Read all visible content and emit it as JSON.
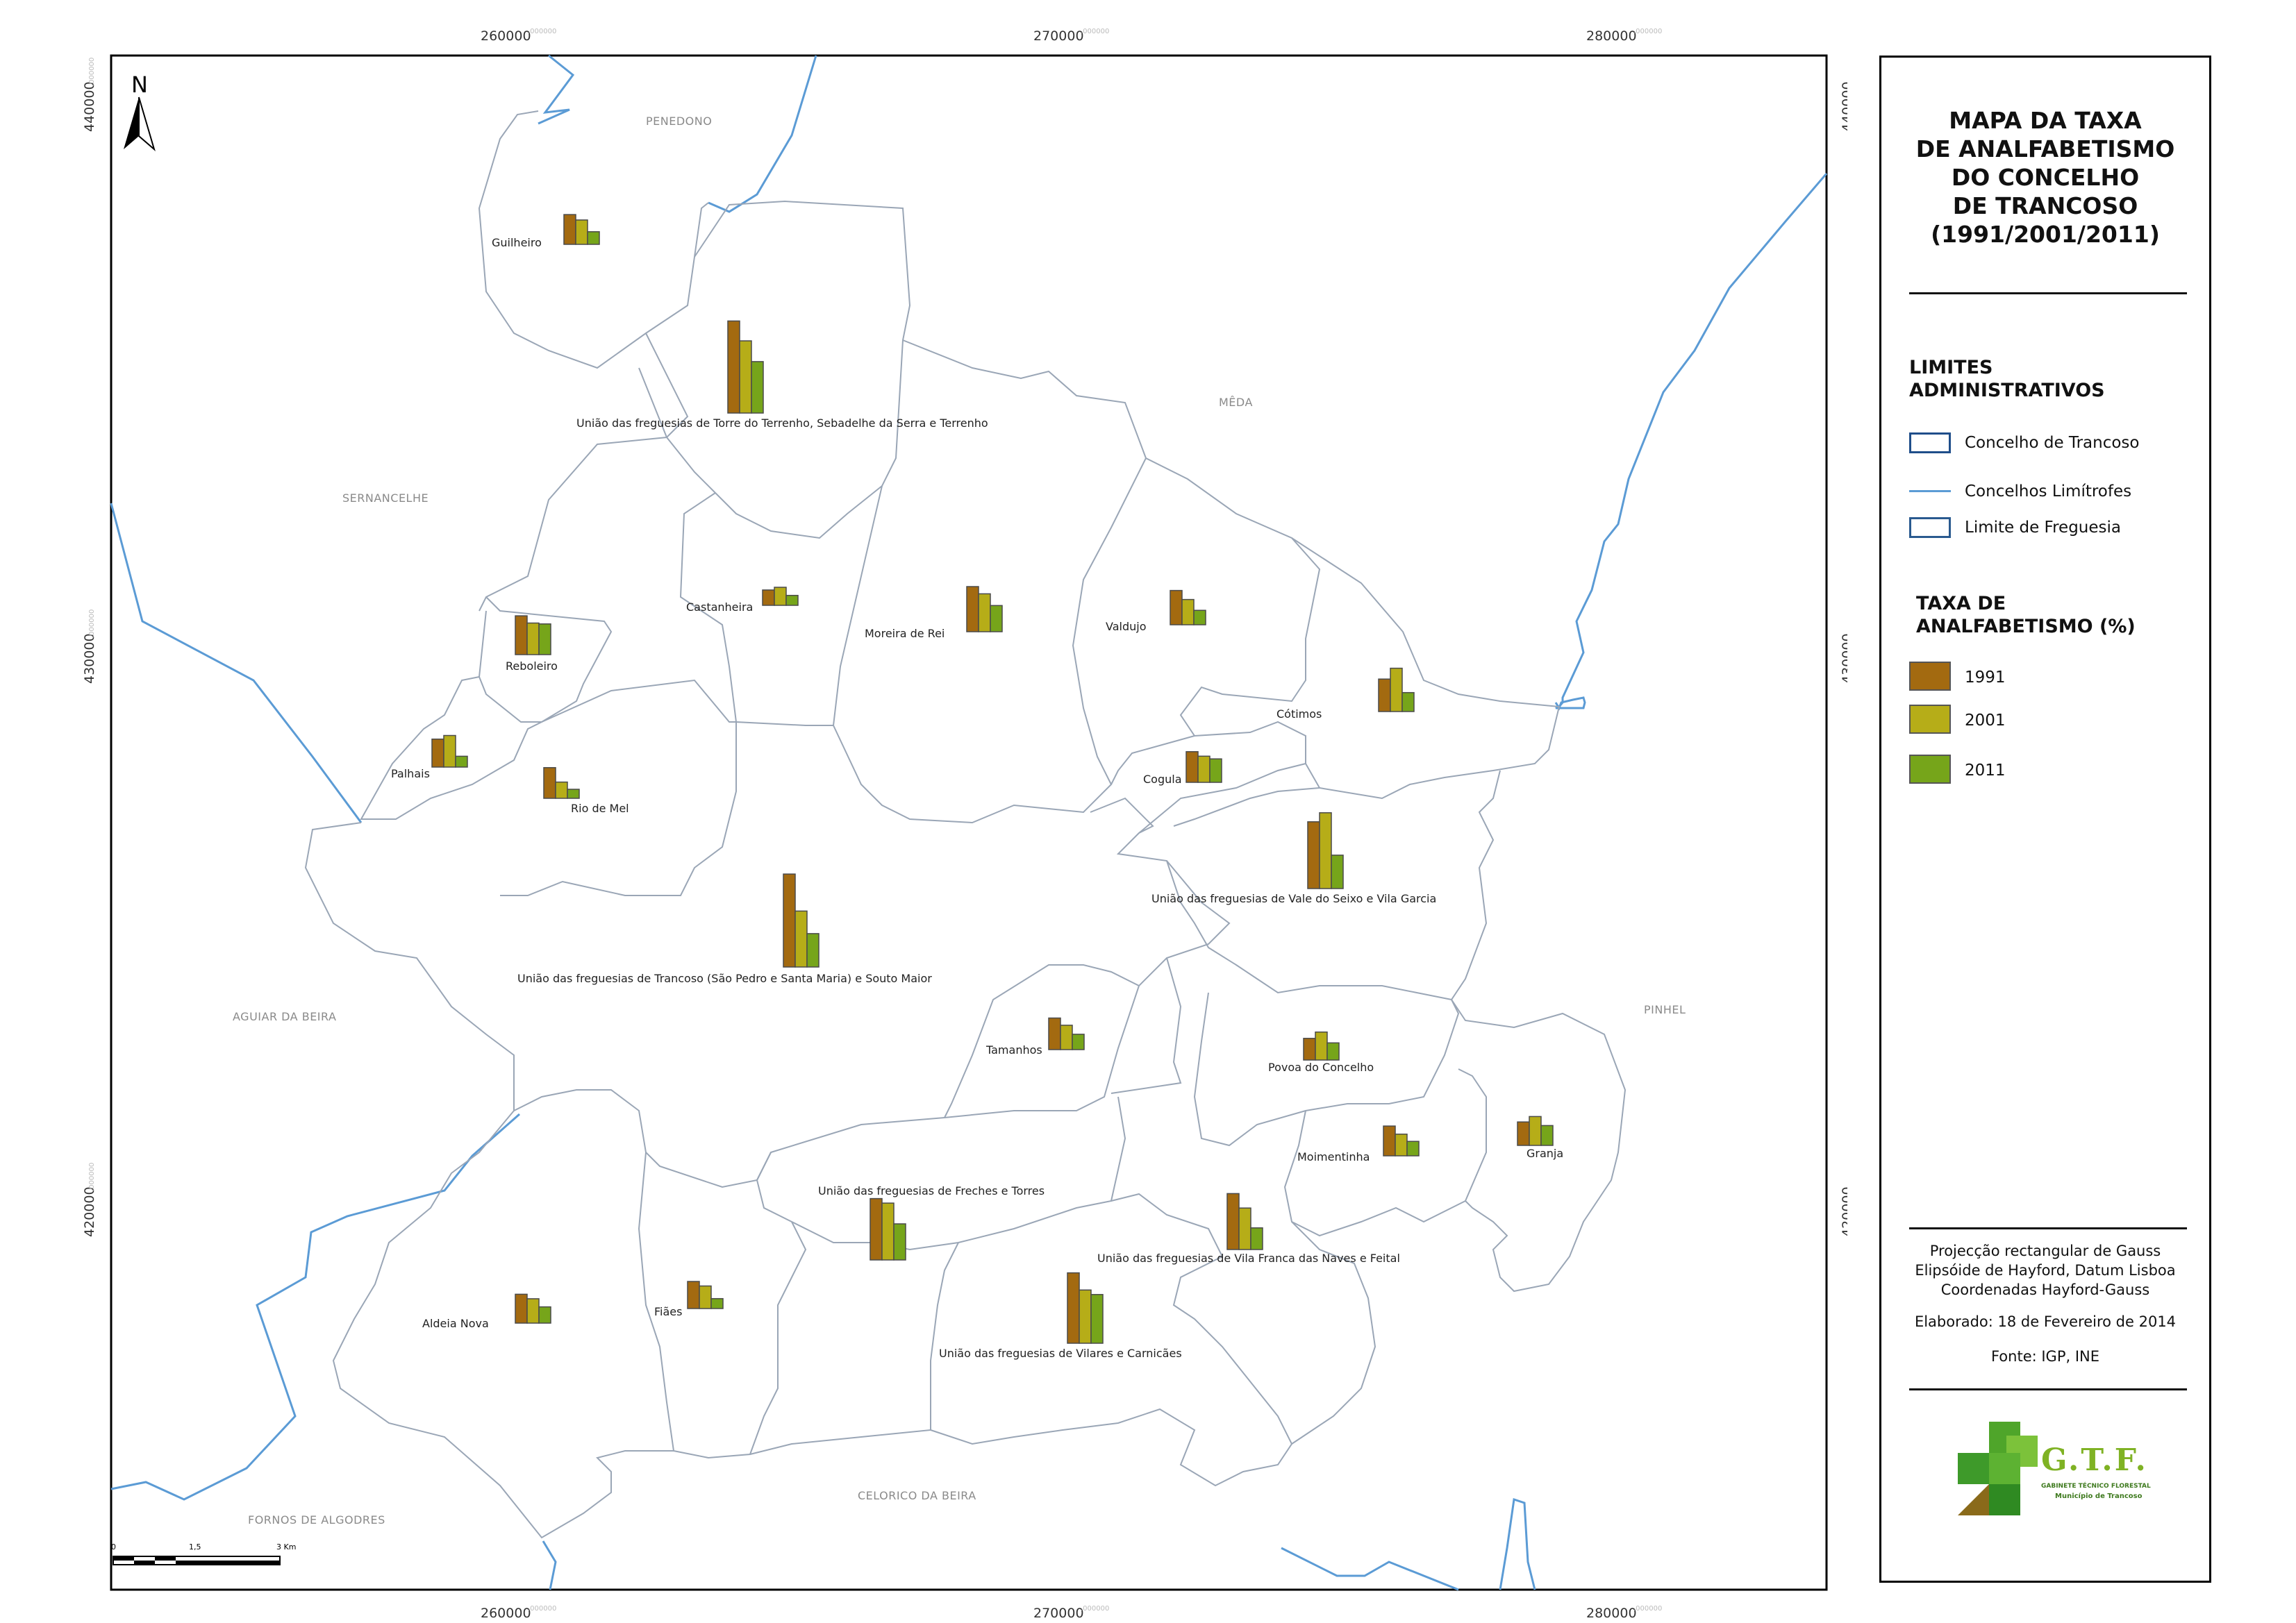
{
  "map": {
    "title": "MAPA DA TAXA\nDE ANALFABETISMO\nDO CONCELHO\nDE TRANCOSO\n(1991/2001/2011)",
    "north_arrow_label": "N",
    "grid": {
      "x_ticks": [
        {
          "label": "260000",
          "fraction": ".000000"
        },
        {
          "label": "270000",
          "fraction": ".000000"
        },
        {
          "label": "280000",
          "fraction": ".000000"
        }
      ],
      "y_ticks": [
        {
          "label": "440000",
          "fraction": ".000000"
        },
        {
          "label": "430000",
          "fraction": ".000000"
        },
        {
          "label": "420000",
          "fraction": ".000000"
        }
      ]
    },
    "scale_bar": {
      "labels": [
        "0",
        "1,5",
        "3 Km"
      ]
    },
    "neighbor_municipalities": [
      "PENEDONO",
      "MÊDA",
      "SERNANCELHE",
      "AGUIAR DA BEIRA",
      "PINHEL",
      "CELORICO DA BEIRA",
      "FORNOS DE ALGODRES"
    ],
    "parishes": [
      {
        "name": "Guilheiro",
        "rates": {
          "1991": 33,
          "2001": 27,
          "2011": 14
        }
      },
      {
        "name": "União das freguesias de Torre do Terrenho, Sebadelhe da Serra e Terrenho",
        "rates": {
          "1991": 102,
          "2001": 80,
          "2011": 57
        }
      },
      {
        "name": "Castanheira",
        "rates": {
          "1991": 17,
          "2001": 20,
          "2011": 11
        }
      },
      {
        "name": "Moreira de Rei",
        "rates": {
          "1991": 50,
          "2001": 42,
          "2011": 29
        }
      },
      {
        "name": "Valdujo",
        "rates": {
          "1991": 38,
          "2001": 28,
          "2011": 16
        }
      },
      {
        "name": "Reboleiro",
        "rates": {
          "1991": 43,
          "2001": 35,
          "2011": 34
        }
      },
      {
        "name": "Cótimos",
        "rates": {
          "1991": 36,
          "2001": 48,
          "2011": 21
        }
      },
      {
        "name": "Palhais",
        "rates": {
          "1991": 31,
          "2001": 35,
          "2011": 12
        }
      },
      {
        "name": "Rio de Mel",
        "rates": {
          "1991": 34,
          "2001": 18,
          "2011": 10
        }
      },
      {
        "name": "Cogula",
        "rates": {
          "1991": 34,
          "2001": 29,
          "2011": 26
        }
      },
      {
        "name": "União das freguesias de Vale do Seixo e Vila Garcia",
        "rates": {
          "1991": 74,
          "2001": 84,
          "2011": 37
        }
      },
      {
        "name": "União das freguesias de Trancoso (São Pedro e Santa Maria) e Souto Maior",
        "rates": {
          "1991": 103,
          "2001": 62,
          "2011": 37
        }
      },
      {
        "name": "Tamanhos",
        "rates": {
          "1991": 35,
          "2001": 27,
          "2011": 17
        }
      },
      {
        "name": "Povoa do Concelho",
        "rates": {
          "1991": 24,
          "2001": 31,
          "2011": 19
        }
      },
      {
        "name": "Moimentinha",
        "rates": {
          "1991": 33,
          "2001": 24,
          "2011": 16
        }
      },
      {
        "name": "Granja",
        "rates": {
          "1991": 26,
          "2001": 32,
          "2011": 22
        }
      },
      {
        "name": "União das freguesias de Freches e Torres",
        "rates": {
          "1991": 68,
          "2001": 63,
          "2011": 40
        }
      },
      {
        "name": "União das freguesias de Vila Franca das Naves e Feital",
        "rates": {
          "1991": 62,
          "2001": 46,
          "2011": 24
        }
      },
      {
        "name": "Aldeia Nova",
        "rates": {
          "1991": 32,
          "2001": 27,
          "2011": 18
        }
      },
      {
        "name": "Fiães",
        "rates": {
          "1991": 30,
          "2001": 25,
          "2011": 11
        }
      },
      {
        "name": "União das freguesias de Vilares e Carnicães",
        "rates": {
          "1991": 78,
          "2001": 59,
          "2011": 54
        }
      }
    ]
  },
  "legend": {
    "admin_heading": "LIMITES\nADMINISTRATIVOS",
    "admin_items": [
      {
        "label": "Concelho de Trancoso"
      },
      {
        "label": "Concelhos Limítrofes"
      },
      {
        "label": "Limite de Freguesia"
      }
    ],
    "rate_heading": "TAXA DE\nANALFABETISMO (%)",
    "rate_items": [
      {
        "label": "1991",
        "color": "#a36a10"
      },
      {
        "label": "2001",
        "color": "#b6ad18"
      },
      {
        "label": "2011",
        "color": "#76a51a"
      }
    ],
    "notes": {
      "projection_1": "Projecção rectangular de Gauss",
      "projection_2": "Elipsóide de Hayford, Datum Lisboa",
      "projection_3": "Coordenadas Hayford-Gauss",
      "made": "Elaborado: 18 de Fevereiro de 2014",
      "source": "Fonte: IGP, INE"
    }
  },
  "logo": {
    "name": "G.T.F.",
    "subtitle": "GABINETE TÉCNICO FLORESTAL",
    "municipality": "Município de Trancoso"
  },
  "colors": {
    "municipal_boundary": "#9aa6b6",
    "neighbor_boundary": "#5b9bd5",
    "bar_1991": "#a36a10",
    "bar_2001": "#b6ad18",
    "bar_2011": "#76a51a"
  }
}
